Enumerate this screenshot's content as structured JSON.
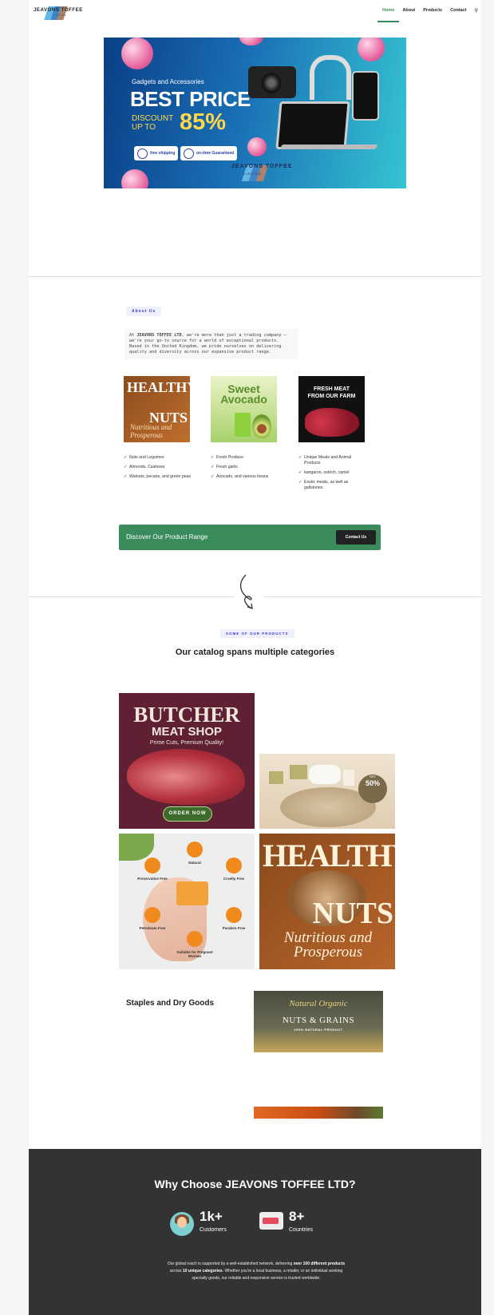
{
  "brand": {
    "name": "JEAVONS TOFFEE",
    "sub": "LIMITED",
    "bar_colors": [
      "#62b7e6",
      "#3f83c9",
      "#a8836a"
    ]
  },
  "nav": {
    "items": [
      "Home",
      "About",
      "Products",
      "Contact"
    ],
    "active": "Home",
    "accent": "#3a8c5c"
  },
  "hero": {
    "kicker": "Gadgets and Accessories",
    "headline": "BEST PRICE",
    "discount_label_1": "DISCOUNT",
    "discount_label_2": "UP TO",
    "discount_value": "85%",
    "badge1": "free shipping",
    "badge2": "on-time Guaranteed",
    "logo": "JEAVONS TOFFEE",
    "logo_sub": "LIMITED"
  },
  "about": {
    "tag": "About Us",
    "text_prefix": "At ",
    "text_strong": "JEAVONS TOFFEE LTD",
    "text_rest": ", we're more than just a trading company — we're your go-to source for a world of exceptional products. Based in the United Kingdom, we pride ourselves on delivering quality and diversity across our expansive product range.",
    "cards": [
      {
        "img_title_1": "HEALTHY",
        "img_title_2": "NUTS",
        "img_script": "Nutritious and Prosperous",
        "items": [
          "Nuts and Legumes",
          "Almonds, Cashews",
          "Walnuts, pecans, and green peas"
        ]
      },
      {
        "img_title_1": "Sweet",
        "img_title_2": "Avocado",
        "items": [
          "Fresh Produce",
          "Fresh garlic",
          "Avocado, and various beans"
        ]
      },
      {
        "img_title_1": "FRESH MEAT",
        "img_title_2": "FROM OUR FARM",
        "items": [
          "Unique Meats and Animal Products",
          "kangaroo, ostrich, camel",
          "Exotic meats, as well as gallstones"
        ]
      }
    ],
    "cta_text": "Discover Our Product Range",
    "cta_button": "Contact Us"
  },
  "products": {
    "tag": "SOME OF OUR PRODUCTS",
    "heading": "Our catalog spans multiple categories",
    "butcher": {
      "title": "BUTCHER",
      "subtitle": "MEAT SHOP",
      "tagline": "Prime Cuts, Premium Quality!",
      "button": "ORDER NOW"
    },
    "spa": {
      "badge_top": "GET",
      "badge_value": "50%"
    },
    "soap": {
      "features": [
        "Natural",
        "Preservative Free",
        "Cruelty Free",
        "Petroleum Free",
        "Paraben Free",
        "Suitable for Pregnant Woman"
      ]
    },
    "nuts": {
      "title_1": "HEALTHY",
      "title_2": "NUTS",
      "script": "Nutritious and Prosperous"
    },
    "staples_heading": "Staples and Dry Goods",
    "grains": {
      "script": "Natural Organic",
      "title": "NUTS & GRAINS",
      "sub": "100% NATURAL PRODUCT"
    }
  },
  "footer": {
    "heading": "Why Choose JEAVONS TOFFEE LTD?",
    "stats": [
      {
        "value": "1k+",
        "label": "Customers"
      },
      {
        "value": "8+",
        "label": "Countries"
      }
    ],
    "text_1": "Our global reach is supported by a well-established network, delivering ",
    "text_b1": "over 100 different products",
    "text_2": " across ",
    "text_b2": "10 unique categories",
    "text_3": ". Whether you're a local business, a retailer, or an individual seeking specialty goods, our reliable and responsive service is trusted worldwide."
  }
}
